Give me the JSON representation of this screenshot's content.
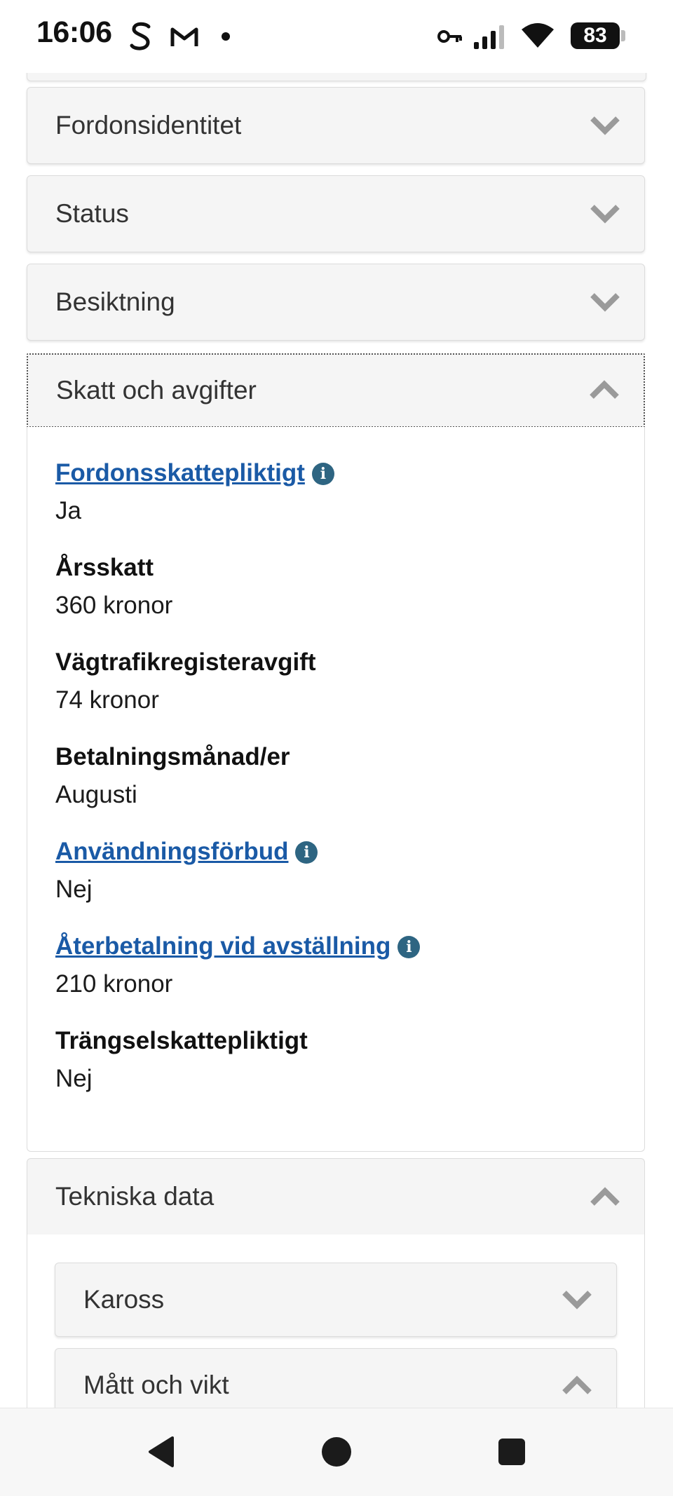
{
  "status_bar": {
    "time": "16:06",
    "battery": "83",
    "icons": [
      "s-app-icon",
      "gmail-icon",
      "dot-icon",
      "key-icon",
      "signal-icon",
      "wifi-icon",
      "battery-icon"
    ]
  },
  "accordions": [
    {
      "title": "Fordonsidentitet",
      "state": "collapsed"
    },
    {
      "title": "Status",
      "state": "collapsed"
    },
    {
      "title": "Besiktning",
      "state": "collapsed"
    },
    {
      "title": "Skatt och avgifter",
      "state": "expanded"
    }
  ],
  "tax_section": {
    "fields": [
      {
        "label": "Fordonsskattepliktigt",
        "value": "Ja",
        "is_link": true,
        "has_info": true
      },
      {
        "label": "Årsskatt",
        "value": "360 kronor",
        "is_link": false,
        "has_info": false
      },
      {
        "label": "Vägtrafikregisteravgift",
        "value": "74 kronor",
        "is_link": false,
        "has_info": false
      },
      {
        "label": "Betalningsmånad/er",
        "value": "Augusti",
        "is_link": false,
        "has_info": false
      },
      {
        "label": "Användningsförbud",
        "value": "Nej",
        "is_link": true,
        "has_info": true
      },
      {
        "label": "Återbetalning vid avställning",
        "value": "210 kronor",
        "is_link": true,
        "has_info": true
      },
      {
        "label": "Trängselskattepliktigt",
        "value": "Nej",
        "is_link": false,
        "has_info": false
      }
    ]
  },
  "technical": {
    "title": "Tekniska data",
    "state": "expanded",
    "sub_accordions": [
      {
        "title": "Kaross",
        "state": "collapsed"
      },
      {
        "title": "Mått och vikt",
        "state": "expanded"
      }
    ]
  },
  "colors": {
    "link": "#1a5aa6",
    "info_icon": "#2e6582",
    "panel_bg": "#f5f5f5"
  }
}
